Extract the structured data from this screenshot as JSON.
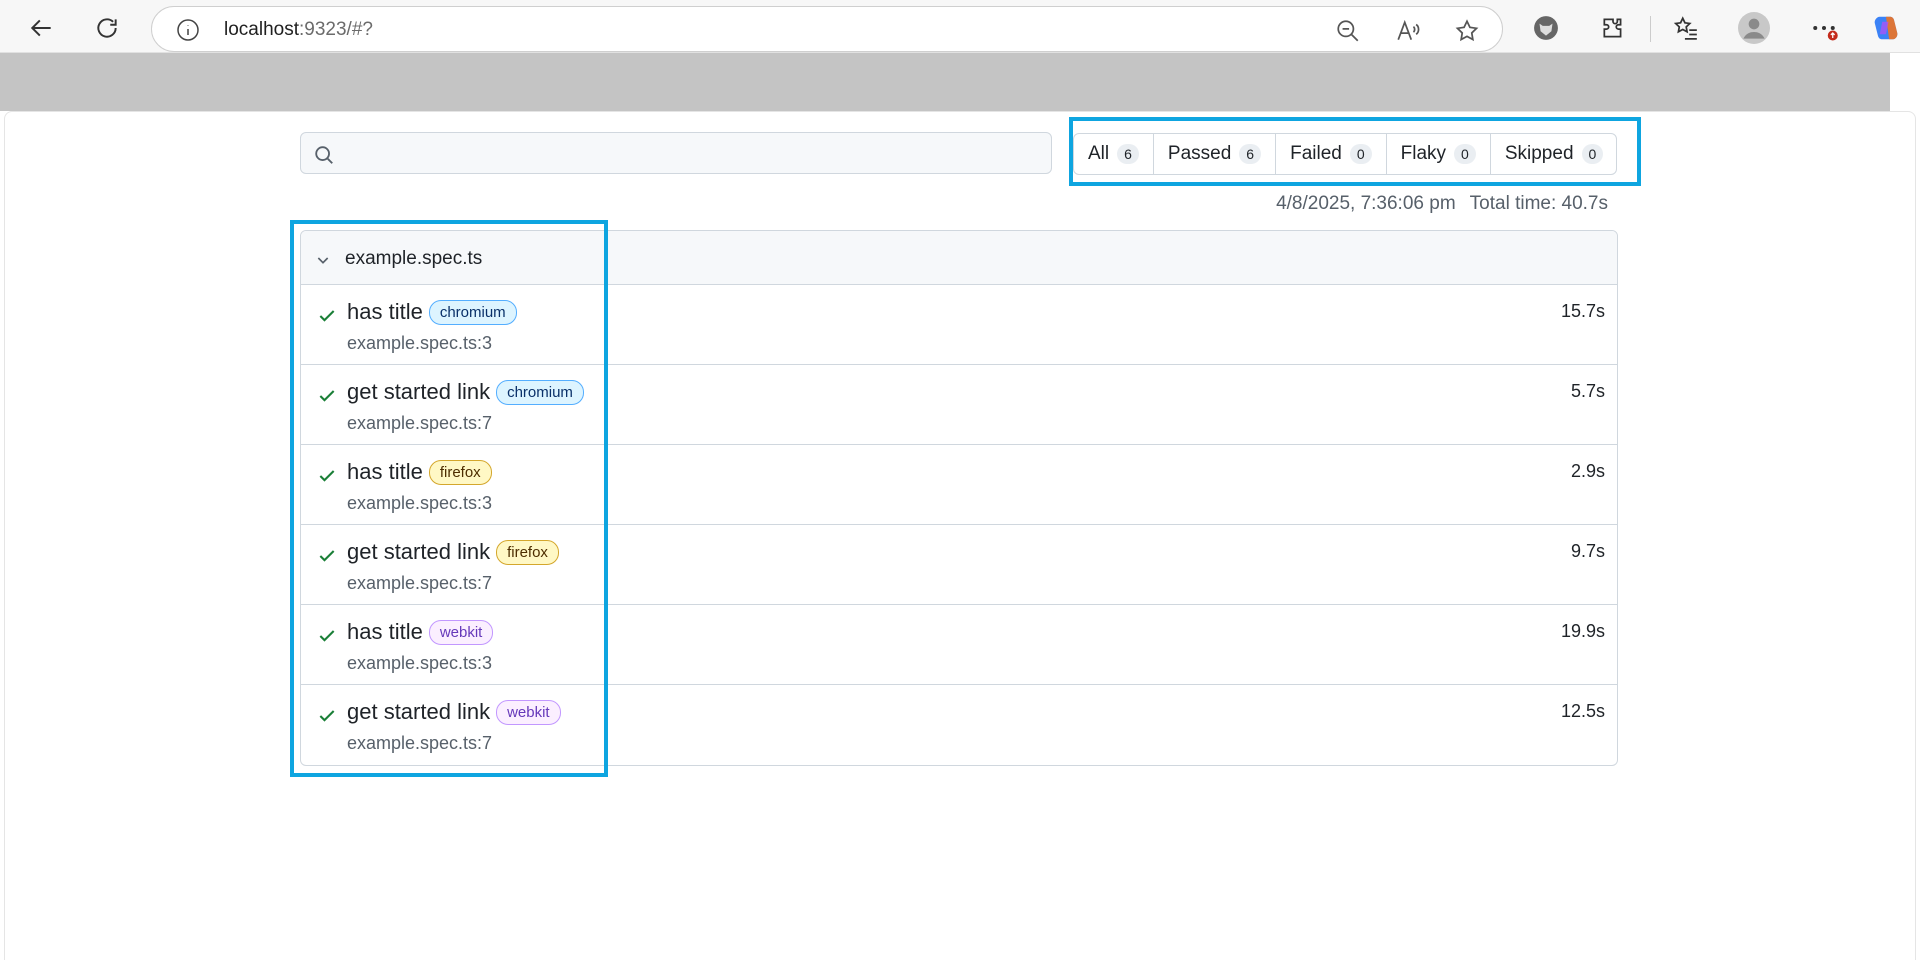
{
  "browser": {
    "url_host": "localhost",
    "url_rest": ":9323/#?",
    "colors": {
      "accent_highlight": "#0ea5e0",
      "pass_check": "#1a7f37"
    }
  },
  "search": {
    "placeholder": ""
  },
  "filters": [
    {
      "label": "All",
      "count": "6"
    },
    {
      "label": "Passed",
      "count": "6"
    },
    {
      "label": "Failed",
      "count": "0"
    },
    {
      "label": "Flaky",
      "count": "0"
    },
    {
      "label": "Skipped",
      "count": "0"
    }
  ],
  "meta": {
    "datetime": "4/8/2025, 7:36:06 pm",
    "total_time": "Total time: 40.7s"
  },
  "file": {
    "name": "example.spec.ts",
    "tests": [
      {
        "name": "has title",
        "project": "chromium",
        "location": "example.spec.ts:3",
        "duration": "15.7s",
        "status": "passed"
      },
      {
        "name": "get started link",
        "project": "chromium",
        "location": "example.spec.ts:7",
        "duration": "5.7s",
        "status": "passed"
      },
      {
        "name": "has title",
        "project": "firefox",
        "location": "example.spec.ts:3",
        "duration": "2.9s",
        "status": "passed"
      },
      {
        "name": "get started link",
        "project": "firefox",
        "location": "example.spec.ts:7",
        "duration": "9.7s",
        "status": "passed"
      },
      {
        "name": "has title",
        "project": "webkit",
        "location": "example.spec.ts:3",
        "duration": "19.9s",
        "status": "passed"
      },
      {
        "name": "get started link",
        "project": "webkit",
        "location": "example.spec.ts:7",
        "duration": "12.5s",
        "status": "passed"
      }
    ]
  }
}
